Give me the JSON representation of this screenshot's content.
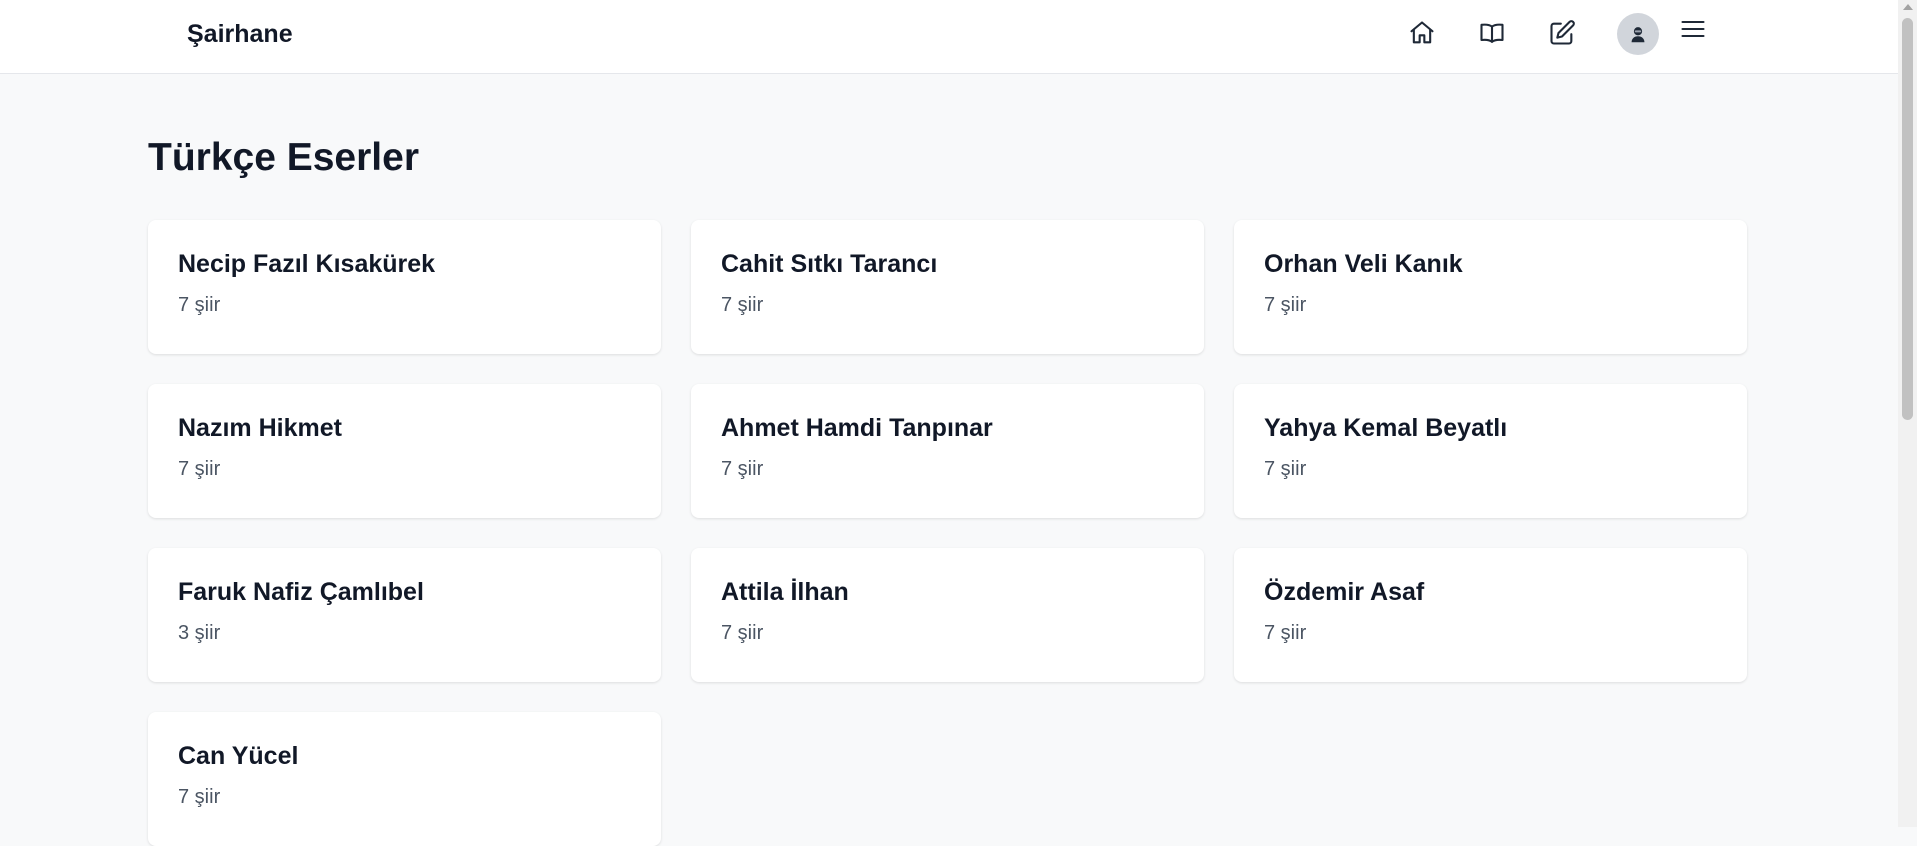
{
  "header": {
    "brand": "Şairhane",
    "icons": [
      "home-icon",
      "book-icon",
      "edit-icon",
      "avatar-icon",
      "menu-icon"
    ]
  },
  "main": {
    "title": "Türkçe Eserler",
    "poets": [
      {
        "name": "Necip Fazıl Kısakürek",
        "count": "7 şiir"
      },
      {
        "name": "Cahit Sıtkı Tarancı",
        "count": "7 şiir"
      },
      {
        "name": "Orhan Veli Kanık",
        "count": "7 şiir"
      },
      {
        "name": "Nazım Hikmet",
        "count": "7 şiir"
      },
      {
        "name": "Ahmet Hamdi Tanpınar",
        "count": "7 şiir"
      },
      {
        "name": "Yahya Kemal Beyatlı",
        "count": "7 şiir"
      },
      {
        "name": "Faruk Nafiz Çamlıbel",
        "count": "3 şiir"
      },
      {
        "name": "Attila İlhan",
        "count": "7 şiir"
      },
      {
        "name": "Özdemir Asaf",
        "count": "7 şiir"
      },
      {
        "name": "Can Yücel",
        "count": "7 şiir"
      }
    ]
  },
  "colors": {
    "background": "#f8f9fa",
    "card": "#ffffff",
    "text": "#111827",
    "muted": "#4b5563"
  }
}
